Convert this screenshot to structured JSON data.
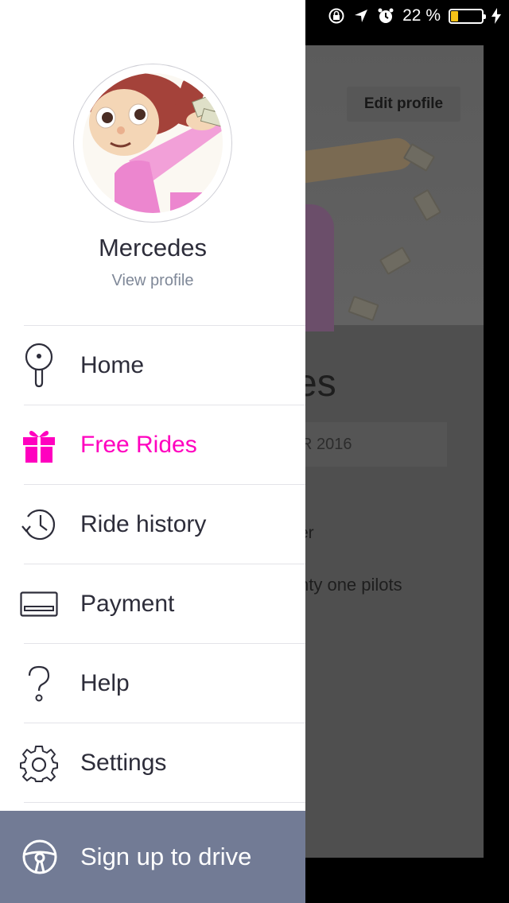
{
  "status_bar": {
    "battery_text": "22 %",
    "battery_level": 0.22,
    "battery_color": "#f7c318",
    "icons": [
      "orientation-lock-icon",
      "location-arrow-icon",
      "alarm-icon",
      "battery-icon",
      "charging-bolt-icon"
    ]
  },
  "background": {
    "edit_profile_label": "Edit profile",
    "name_partial": "es",
    "member_since_partial": "R 2016",
    "line1_partial": "er",
    "line2_partial": "nty one pilots"
  },
  "drawer": {
    "user_name": "Mercedes",
    "view_profile_label": "View profile",
    "menu": [
      {
        "label": "Home",
        "icon": "location-pin-icon",
        "highlight": false
      },
      {
        "label": "Free Rides",
        "icon": "gift-icon",
        "highlight": true
      },
      {
        "label": "Ride history",
        "icon": "history-clock-icon",
        "highlight": false
      },
      {
        "label": "Payment",
        "icon": "credit-card-icon",
        "highlight": false
      },
      {
        "label": "Help",
        "icon": "question-icon",
        "highlight": false
      },
      {
        "label": "Settings",
        "icon": "gear-icon",
        "highlight": false
      }
    ],
    "drive_label": "Sign up to drive",
    "drive_icon": "steering-wheel-icon"
  },
  "colors": {
    "accent": "#ff00bf",
    "drive_bar": "#727b95",
    "text": "#2d2d3a",
    "muted": "#7f8898"
  }
}
